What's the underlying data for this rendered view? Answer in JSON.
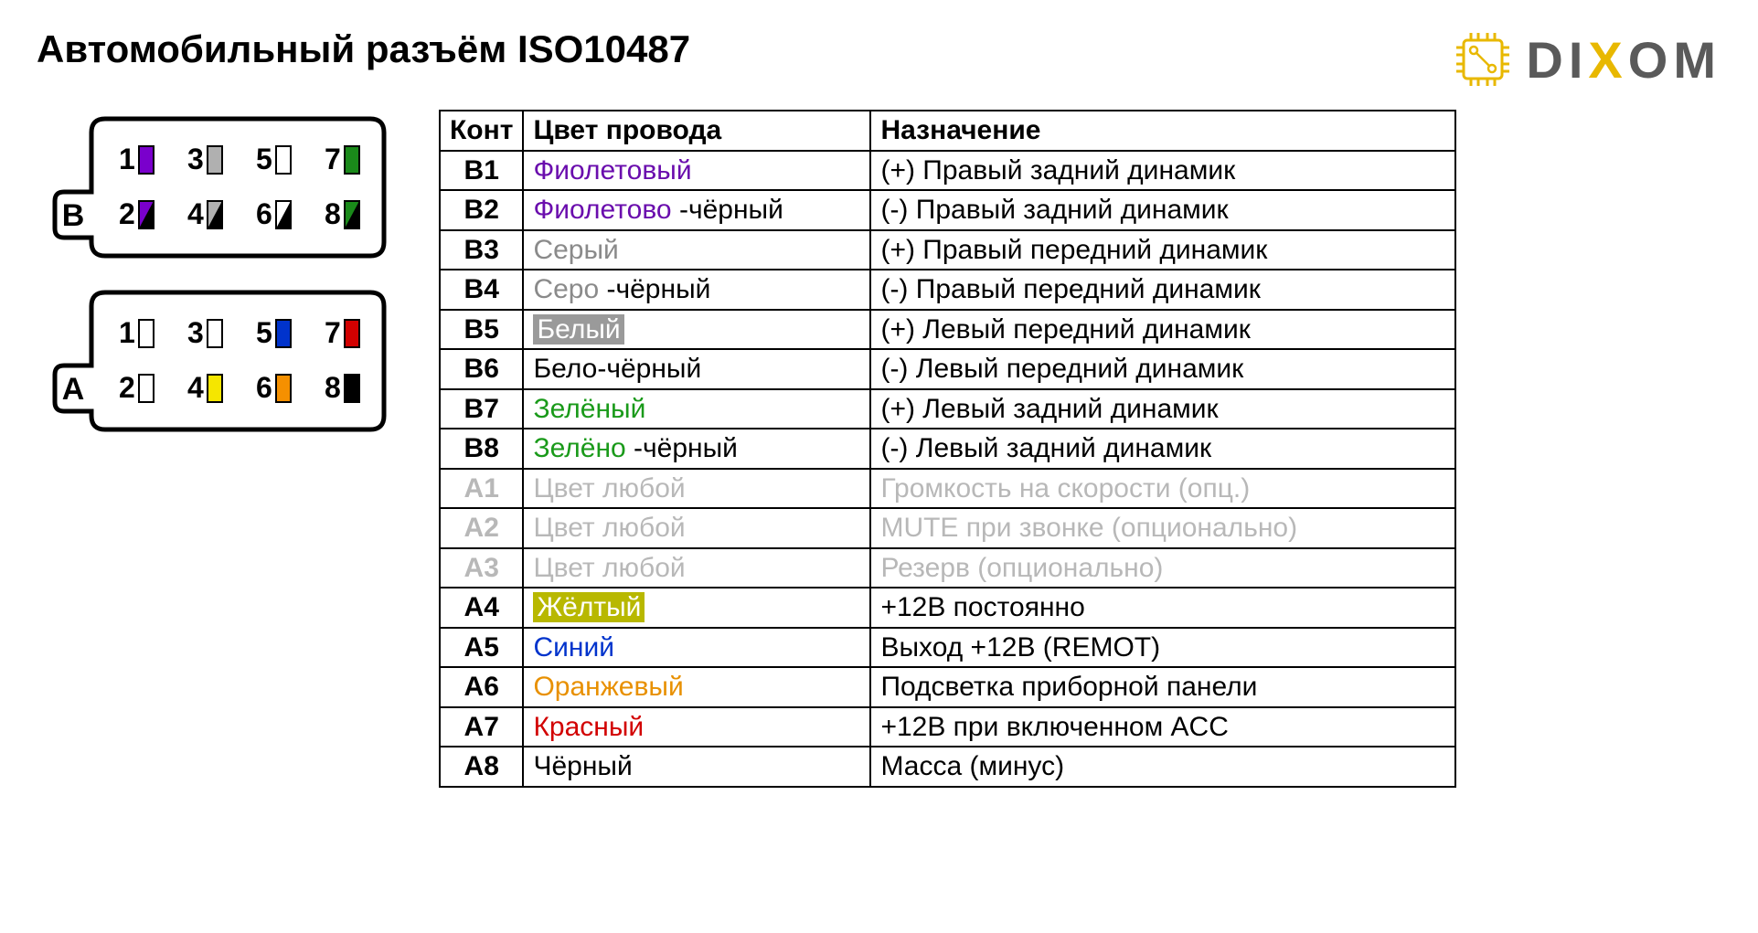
{
  "title": "Автомобильный разъём ISO10487",
  "logo": {
    "d": "D",
    "i": "I",
    "x": "X",
    "o": "O",
    "m": "M"
  },
  "headers": {
    "pin": "Конт",
    "color": "Цвет провода",
    "purpose": "Назначение"
  },
  "rows": [
    {
      "pin": "B1",
      "color_a": "Фиолетовый",
      "color_a_class": "violet",
      "color_b": "",
      "purpose": "(+) Правый задний динамик",
      "dim": false
    },
    {
      "pin": "B2",
      "color_a": "Фиолетово",
      "color_a_class": "violet",
      "color_b": " -чёрный",
      "purpose": "(-)  Правый задний динамик",
      "dim": false
    },
    {
      "pin": "B3",
      "color_a": "Серый",
      "color_a_class": "gray",
      "color_b": "",
      "purpose": "(+) Правый передний динамик",
      "dim": false
    },
    {
      "pin": "B4",
      "color_a": "Серо",
      "color_a_class": "gray",
      "color_b": " -чёрный",
      "purpose": "(-)  Правый передний динамик",
      "dim": false
    },
    {
      "pin": "B5",
      "color_a": "Белый",
      "color_a_class": "white-hl",
      "color_b": "",
      "purpose": "(+) Левый передний динамик",
      "dim": false
    },
    {
      "pin": "B6",
      "color_a": "Бело-чёрный",
      "color_a_class": "",
      "color_b": "",
      "purpose": "(-)  Левый передний динамик",
      "dim": false
    },
    {
      "pin": "B7",
      "color_a": "Зелёный",
      "color_a_class": "green",
      "color_b": "",
      "purpose": "(+) Левый задний динамик",
      "dim": false
    },
    {
      "pin": "B8",
      "color_a": "Зелёно",
      "color_a_class": "green",
      "color_b": " -чёрный",
      "purpose": "(-)  Левый задний динамик",
      "dim": false
    },
    {
      "pin": "A1",
      "color_a": "Цвет любой",
      "color_a_class": "dim",
      "color_b": "",
      "purpose": "Громкость на скорости (опц.)",
      "dim": true
    },
    {
      "pin": "A2",
      "color_a": "Цвет любой",
      "color_a_class": "dim",
      "color_b": "",
      "purpose": "MUTE при звонке (опционально)",
      "dim": true
    },
    {
      "pin": "A3",
      "color_a": "Цвет любой",
      "color_a_class": "dim",
      "color_b": "",
      "purpose": "Резерв (опционально)",
      "dim": true
    },
    {
      "pin": "A4",
      "color_a": "Жёлтый",
      "color_a_class": "yellow-hl",
      "color_b": "",
      "purpose": "+12В постоянно",
      "dim": false
    },
    {
      "pin": "A5",
      "color_a": "Синий",
      "color_a_class": "blue",
      "color_b": "",
      "purpose": "Выход +12В (REMOT)",
      "dim": false
    },
    {
      "pin": "A6",
      "color_a": "Оранжевый",
      "color_a_class": "orange",
      "color_b": "",
      "purpose": "Подсветка приборной панели",
      "dim": false
    },
    {
      "pin": "A7",
      "color_a": "Красный",
      "color_a_class": "red",
      "color_b": "",
      "purpose": "+12В при включенном ACC",
      "dim": false
    },
    {
      "pin": "A8",
      "color_a": "Чёрный",
      "color_a_class": "",
      "color_b": "",
      "purpose": "Масса (минус)",
      "dim": false
    }
  ],
  "connector": {
    "B": {
      "label": "B",
      "top": [
        {
          "n": "1",
          "fill": "#7a00cc",
          "stripe": ""
        },
        {
          "n": "3",
          "fill": "#b0b0b0",
          "stripe": ""
        },
        {
          "n": "5",
          "fill": "#ffffff",
          "stripe": ""
        },
        {
          "n": "7",
          "fill": "#1a8a1a",
          "stripe": ""
        }
      ],
      "bot": [
        {
          "n": "2",
          "fill": "#7a00cc",
          "stripe": "#000"
        },
        {
          "n": "4",
          "fill": "#b0b0b0",
          "stripe": "#000"
        },
        {
          "n": "6",
          "fill": "#ffffff",
          "stripe": "#000"
        },
        {
          "n": "8",
          "fill": "#1a8a1a",
          "stripe": "#000"
        }
      ]
    },
    "A": {
      "label": "A",
      "top": [
        {
          "n": "1",
          "fill": "#ffffff",
          "stripe": ""
        },
        {
          "n": "3",
          "fill": "#ffffff",
          "stripe": ""
        },
        {
          "n": "5",
          "fill": "#0033cc",
          "stripe": ""
        },
        {
          "n": "7",
          "fill": "#d20000",
          "stripe": ""
        }
      ],
      "bot": [
        {
          "n": "2",
          "fill": "#ffffff",
          "stripe": ""
        },
        {
          "n": "4",
          "fill": "#f5e600",
          "stripe": ""
        },
        {
          "n": "6",
          "fill": "#f59000",
          "stripe": ""
        },
        {
          "n": "8",
          "fill": "#000000",
          "stripe": ""
        }
      ]
    }
  }
}
